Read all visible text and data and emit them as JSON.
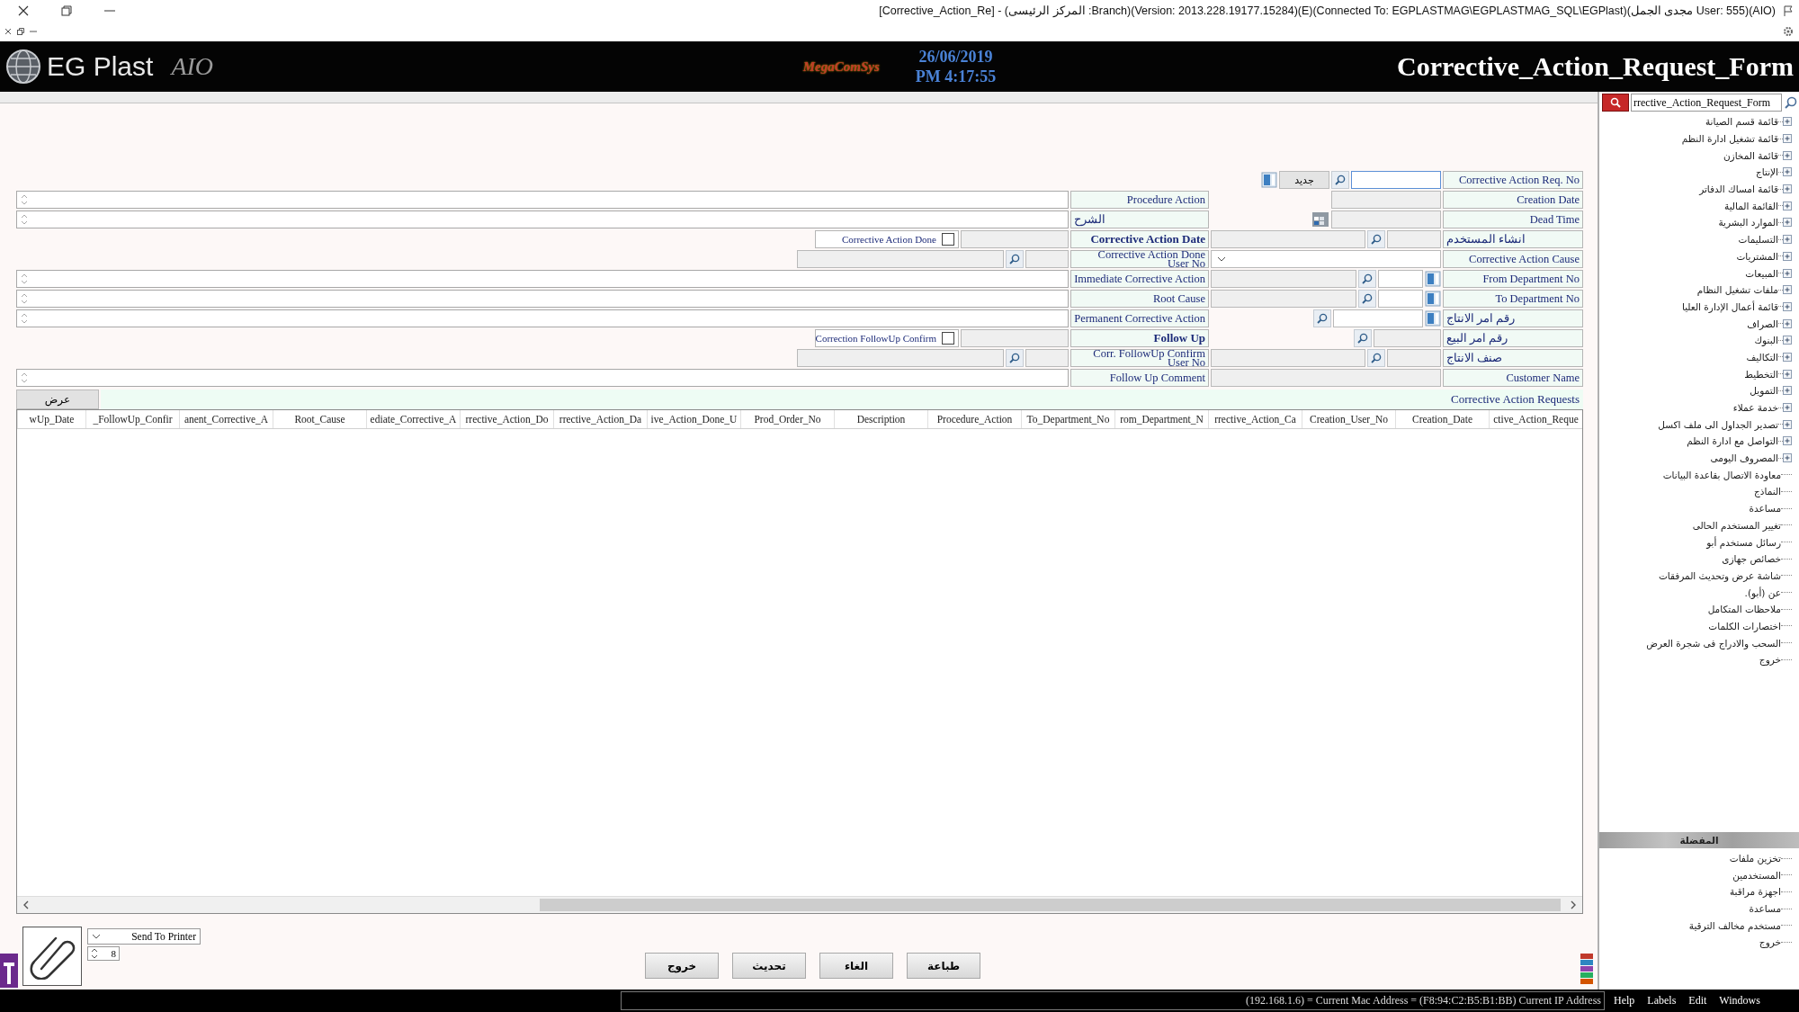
{
  "window": {
    "title": "[Corrective_Action_Re] - (المركز الرئيسى :Branch)(Version: 2013.228.19177.15284)(E)(Connected To: EGPLASTMAG\\EGPLASTMAG_SQL\\EGPlast)(مجدى الجمل User: 555)(AIO)"
  },
  "header": {
    "app_name": "EG Plast",
    "app_suffix": "AIO",
    "vendor": "MegaComSys",
    "date": "26/06/2019",
    "time": "PM 4:17:55",
    "form_title": "Corrective_Action_Request_Form"
  },
  "form": {
    "rows": [
      {
        "right": {
          "label": "Corrective Action Req. No",
          "kind": "req-no",
          "button": "جديد"
        }
      },
      {
        "right": {
          "label": "Creation Date",
          "kind": "short-field"
        },
        "middle": {
          "label": "Procedure Action",
          "kind": "memo",
          "emphasis": false
        }
      },
      {
        "right": {
          "label": "Dead Time",
          "kind": "date-picker"
        },
        "middle": {
          "label": "الشرح",
          "kind": "memo",
          "emphasis": false
        }
      },
      {
        "right": {
          "label": "انشاء المستخدم",
          "kind": "lookup"
        },
        "middle": {
          "label": "Corrective Action Date",
          "kind": "check",
          "emphasis": true,
          "check_label": "Corrective Action Done",
          "checked": false
        }
      },
      {
        "right": {
          "label": "Corrective Action Cause",
          "kind": "select"
        },
        "middle": {
          "label": "Corrective Action Done User No",
          "kind": "lookup",
          "emphasis": false
        }
      },
      {
        "right": {
          "label": "From Department No",
          "kind": "dept"
        },
        "middle": {
          "label": "Immediate Corrective Action",
          "kind": "memo",
          "emphasis": false
        }
      },
      {
        "right": {
          "label": "To Department No",
          "kind": "dept"
        },
        "middle": {
          "label": "Root Cause",
          "kind": "memo",
          "emphasis": false
        }
      },
      {
        "right": {
          "label": "رقم امر الانتاج",
          "kind": "order"
        },
        "middle": {
          "label": "Permanent Corrective Action",
          "kind": "memo",
          "emphasis": false
        }
      },
      {
        "right": {
          "label": "رقم امر البيع",
          "kind": "search-field"
        },
        "middle": {
          "label": "Follow Up",
          "kind": "check",
          "emphasis": true,
          "check_label": "Correction FollowUp Confirm",
          "checked": false
        }
      },
      {
        "right": {
          "label": "صنف الانتاج",
          "kind": "lookup"
        },
        "middle": {
          "label": "Corr. FollowUp Confirm User No",
          "kind": "lookup",
          "emphasis": false
        }
      },
      {
        "right": {
          "label": "Customer Name",
          "kind": "text"
        },
        "middle": {
          "label": "Follow Up Comment",
          "kind": "memo",
          "emphasis": false
        }
      }
    ]
  },
  "requests": {
    "title": "Corrective Action Requests",
    "show_button": "عرض",
    "columns": [
      "ctive_Action_Reque",
      "Creation_Date",
      "Creation_User_No",
      "rrective_Action_Ca",
      "rom_Department_N",
      "To_Department_No",
      "Procedure_Action",
      "Description",
      "Prod_Order_No",
      "ive_Action_Done_U",
      "rrective_Action_Da",
      "rrective_Action_Do",
      "ediate_Corrective_A",
      "Root_Cause",
      "anent_Corrective_A",
      "_FollowUp_Confir",
      "wUp_Date"
    ]
  },
  "bottom": {
    "printer": "Send To Printer",
    "copies": "8",
    "buttons": [
      "طباعة",
      "الغاء",
      "تحديث",
      "خروج"
    ]
  },
  "sidebar": {
    "search": "rrective_Action_Request_Form",
    "tree": [
      {
        "label": "قائمة قسم الصيانة",
        "kind": "folder"
      },
      {
        "label": "قائمة تشغيل ادارة النظم",
        "kind": "folder"
      },
      {
        "label": "قائمة المخازن",
        "kind": "folder"
      },
      {
        "label": "الإنتاج",
        "kind": "folder"
      },
      {
        "label": "قائمة امساك الدفاتر",
        "kind": "folder"
      },
      {
        "label": "القائمة المالية",
        "kind": "folder"
      },
      {
        "label": "الموارد البشرية",
        "kind": "folder"
      },
      {
        "label": "التسليمات",
        "kind": "folder"
      },
      {
        "label": "المشتريات",
        "kind": "folder"
      },
      {
        "label": "المبيعات",
        "kind": "folder"
      },
      {
        "label": "ملفات تشغيل النظام",
        "kind": "folder"
      },
      {
        "label": "قائمة أعمال الإدارة العليا",
        "kind": "folder"
      },
      {
        "label": "الصراف",
        "kind": "folder"
      },
      {
        "label": "البنوك",
        "kind": "folder"
      },
      {
        "label": "التكاليف",
        "kind": "folder"
      },
      {
        "label": "التخطيط",
        "kind": "folder"
      },
      {
        "label": "التمويل",
        "kind": "folder"
      },
      {
        "label": "خدمة عملاء",
        "kind": "folder"
      },
      {
        "label": "تصدير الجداول الى ملف اكسل",
        "kind": "folder"
      },
      {
        "label": "التواصل مع ادارة النظم",
        "kind": "folder"
      },
      {
        "label": "المصروف اليومى",
        "kind": "folder"
      },
      {
        "label": "معاودة الاتصال بقاعدة البيانات",
        "kind": "leaf"
      },
      {
        "label": "النماذج",
        "kind": "leaf"
      },
      {
        "label": "مساعدة",
        "kind": "leaf"
      },
      {
        "label": "تغيير المستخدم الحالى",
        "kind": "leaf"
      },
      {
        "label": "رسائل مستخدم أبو",
        "kind": "leaf"
      },
      {
        "label": "خصائص جهازى",
        "kind": "leaf"
      },
      {
        "label": "شاشة عرض وتحديث المرفقات",
        "kind": "leaf"
      },
      {
        "label": "عن (أبو).",
        "kind": "leaf"
      },
      {
        "label": "ملاحظات المتكامل",
        "kind": "leaf"
      },
      {
        "label": "اختصارات الكلمات",
        "kind": "leaf"
      },
      {
        "label": "السحب والادراج فى شجرة العرض",
        "kind": "leaf"
      },
      {
        "label": "خروج",
        "kind": "leaf"
      }
    ],
    "favorites": {
      "title": "المفضلة",
      "items": [
        "تخزين ملفات",
        "المستخدمين",
        "اجهزة مراقبة",
        "مساعدة",
        "مستخدم مخالف الترقية",
        "خروج"
      ]
    }
  },
  "status_bar": {
    "address": "(192.168.1.6) = Current Mac Address = (F8:94:C2:B5:B1:BB) Current IP Address",
    "menu": [
      "Windows",
      "Edit",
      "Labels",
      "Help"
    ]
  }
}
